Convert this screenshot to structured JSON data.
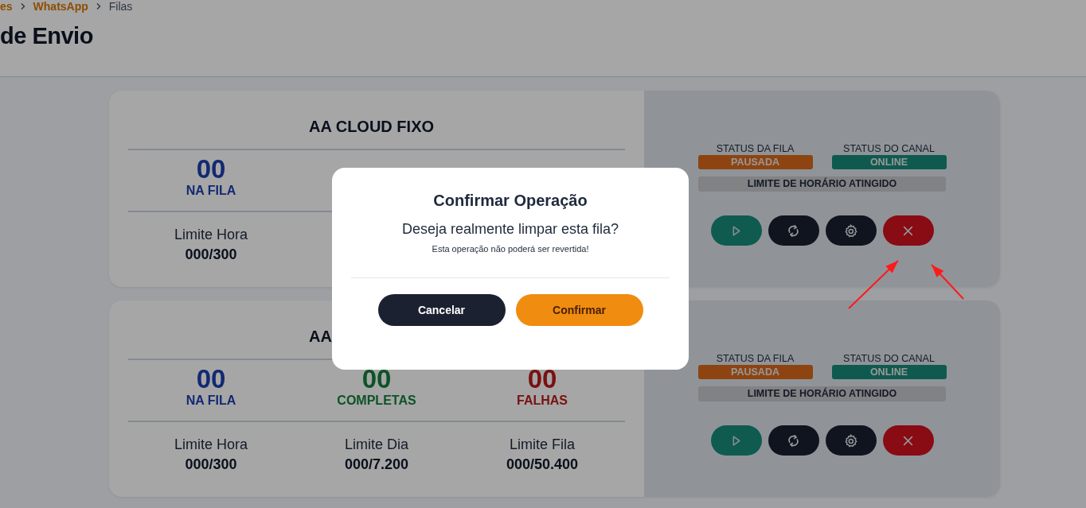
{
  "breadcrumb": [
    {
      "label": "es",
      "kind": "link"
    },
    {
      "label": "WhatsApp",
      "kind": "link"
    },
    {
      "label": "Filas",
      "kind": "current"
    }
  ],
  "page_title": "de Envio",
  "cards": [
    {
      "title": "AA CLOUD FIXO",
      "stats": [
        {
          "kind": "queued",
          "value": "00",
          "label": "NA FILA"
        }
      ],
      "limits": [
        {
          "label": "Limite Hora",
          "value": "000/300"
        }
      ],
      "status": [
        {
          "label": "STATUS DA FILA",
          "value": "PAUSADA",
          "kind": "paused"
        },
        {
          "label": "STATUS DO CANAL",
          "value": "ONLINE",
          "kind": "online"
        }
      ],
      "notice": "LIMITE DE HORÁRIO ATINGIDO",
      "actions": [
        {
          "kind": "play"
        },
        {
          "kind": "sync"
        },
        {
          "kind": "settings"
        },
        {
          "kind": "clear"
        }
      ]
    },
    {
      "title": "AA",
      "stats": [
        {
          "kind": "queued",
          "value": "00",
          "label": "NA FILA"
        },
        {
          "kind": "done",
          "value": "00",
          "label": "COMPLETAS"
        },
        {
          "kind": "failed",
          "value": "00",
          "label": "FALHAS"
        }
      ],
      "limits": [
        {
          "label": "Limite Hora",
          "value": "000/300"
        },
        {
          "label": "Limite Dia",
          "value": "000/7.200"
        },
        {
          "label": "Limite Fila",
          "value": "000/50.400"
        }
      ],
      "status": [
        {
          "label": "STATUS DA FILA",
          "value": "PAUSADA",
          "kind": "paused"
        },
        {
          "label": "STATUS DO CANAL",
          "value": "ONLINE",
          "kind": "online"
        }
      ],
      "notice": "LIMITE DE HORÁRIO ATINGIDO",
      "actions": [
        {
          "kind": "play"
        },
        {
          "kind": "sync"
        },
        {
          "kind": "settings"
        },
        {
          "kind": "clear"
        }
      ]
    }
  ],
  "dialog": {
    "title": "Confirmar Operação",
    "question": "Deseja realmente limpar esta fila?",
    "note": "Esta operação não poderá ser revertida!",
    "buttons": [
      {
        "label": "Cancelar",
        "kind": "cancel"
      },
      {
        "label": "Confirmar",
        "kind": "confirm"
      }
    ]
  },
  "annotations": [
    {
      "kind": "arrow"
    },
    {
      "kind": "arrow"
    }
  ]
}
